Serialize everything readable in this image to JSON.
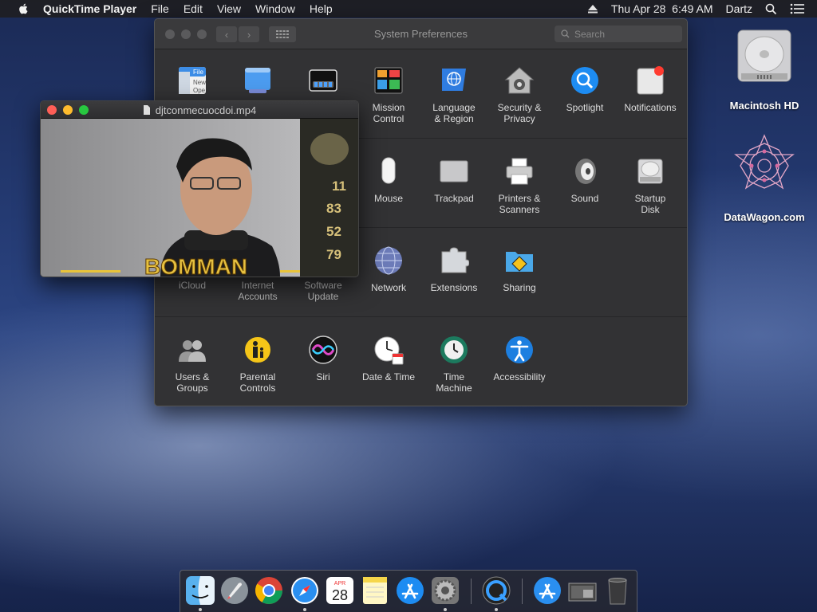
{
  "menubar": {
    "app_name": "QuickTime Player",
    "items": [
      "File",
      "Edit",
      "View",
      "Window",
      "Help"
    ],
    "datetime": "Thu Apr 28  6:49 AM",
    "user": "Dartz"
  },
  "sysprefs": {
    "title": "System Preferences",
    "search_placeholder": "Search",
    "row1": [
      "File New Ope",
      "",
      "",
      "Mission Control",
      "Language & Region",
      "Security & Privacy",
      "Spotlight",
      "Notifications"
    ],
    "row2": [
      "Mouse",
      "Trackpad",
      "Printers & Scanners",
      "Sound",
      "Startup Disk"
    ],
    "row3": [
      "iCloud",
      "Internet Accounts",
      "Software Update",
      "Network",
      "Extensions",
      "Sharing"
    ],
    "row4": [
      "Users & Groups",
      "Parental Controls",
      "Siri",
      "Date & Time",
      "Time Machine",
      "Accessibility"
    ],
    "general_icon_text": [
      "File",
      "New",
      "Ope"
    ]
  },
  "quicktime": {
    "title": "djtconmecuocdoi.mp4",
    "video_caption": "BOMMAN",
    "scoreboard": [
      "11",
      "83",
      "52",
      "79"
    ]
  },
  "desktop": {
    "icons": [
      "Macintosh HD",
      "DataWagon.com"
    ]
  },
  "dock": {
    "calendar_month": "APR",
    "calendar_day": "28",
    "items": [
      "finder",
      "launchpad",
      "chrome",
      "safari",
      "calendar",
      "notes",
      "app-store",
      "system-preferences",
      "quicktime",
      "app-store-downloads",
      "screenshots",
      "trash"
    ]
  },
  "colors": {
    "menubar_bg": "#1e1e22",
    "window_bg": "#323234",
    "accent_blue": "#1a8cff",
    "close_red": "#ff5f57",
    "minimize_yellow": "#febc2e",
    "zoom_green": "#28c840"
  }
}
